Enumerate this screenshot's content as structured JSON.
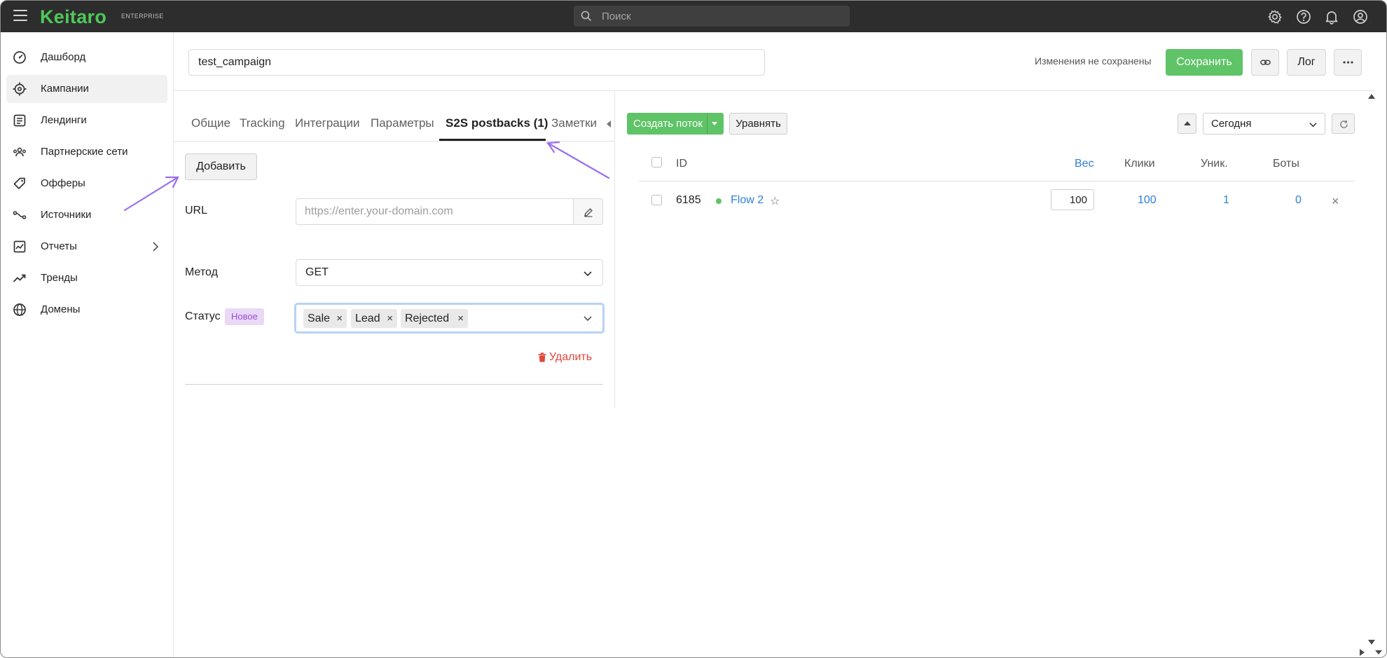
{
  "app": {
    "logo": "Keitaro",
    "logo_sub": "ENTERPRISE",
    "search_placeholder": "Поиск"
  },
  "topbar_icons": [
    "gear-icon",
    "help-icon",
    "bell-icon",
    "user-icon"
  ],
  "sidebar": {
    "items": [
      {
        "label": "Дашборд",
        "icon": "dashboard-icon"
      },
      {
        "label": "Кампании",
        "icon": "target-icon",
        "active": true
      },
      {
        "label": "Лендинги",
        "icon": "landing-icon"
      },
      {
        "label": "Партнерские сети",
        "icon": "people-icon"
      },
      {
        "label": "Офферы",
        "icon": "tag-icon"
      },
      {
        "label": "Источники",
        "icon": "source-icon"
      },
      {
        "label": "Отчеты",
        "icon": "report-icon",
        "has_submenu": true
      },
      {
        "label": "Тренды",
        "icon": "trend-icon"
      },
      {
        "label": "Домены",
        "icon": "globe-icon"
      }
    ]
  },
  "header": {
    "campaign_name": "test_campaign",
    "unsaved_text": "Изменения не сохранены",
    "save_label": "Сохранить",
    "log_label": "Лог"
  },
  "tabs": [
    {
      "label": "Общие"
    },
    {
      "label": "Tracking"
    },
    {
      "label": "Интеграции"
    },
    {
      "label": "Параметры"
    },
    {
      "label": "S2S postbacks (1)",
      "active": true
    },
    {
      "label": "Заметки"
    }
  ],
  "postback": {
    "add_label": "Добавить",
    "url_label": "URL",
    "url_placeholder": "https://enter.your-domain.com",
    "method_label": "Метод",
    "method_value": "GET",
    "status_label": "Статус",
    "status_badge": "Новое",
    "status_chips": [
      "Sale",
      "Lead",
      "Rejected"
    ],
    "chip_remove": "×",
    "delete_label": "Удалить"
  },
  "flows": {
    "create_label": "Создать поток",
    "equalize_label": "Уравнять",
    "period_value": "Сегодня",
    "columns": {
      "id": "ID",
      "weight": "Вес",
      "clicks": "Клики",
      "unique": "Уник.",
      "bots": "Боты"
    },
    "rows": [
      {
        "id": "6185",
        "name": "Flow 2",
        "star": "☆",
        "weight": "100",
        "clicks": "100",
        "unique": "1",
        "bots": "0",
        "remove": "×"
      }
    ]
  },
  "colors": {
    "brand_green": "#5fc367",
    "link_blue": "#2f7fdb",
    "annotation_purple": "#9b6ef0",
    "badge_bg": "#ead8f7",
    "danger_red": "#e0463a"
  }
}
